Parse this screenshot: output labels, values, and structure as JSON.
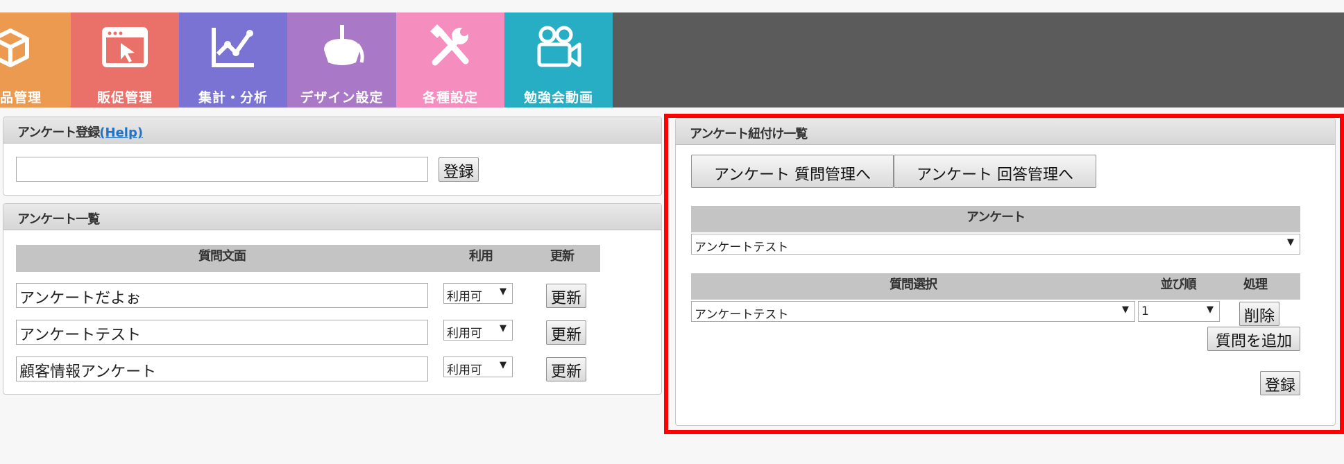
{
  "nav": [
    {
      "label": "品管理",
      "bg": "#ec9a4f",
      "icon": "box-icon"
    },
    {
      "label": "販促管理",
      "bg": "#e9716a",
      "icon": "browser-cursor-icon"
    },
    {
      "label": "集計・分析",
      "bg": "#7a73d4",
      "icon": "line-chart-icon"
    },
    {
      "label": "デザイン設定",
      "bg": "#a978c6",
      "icon": "paint-bucket-icon"
    },
    {
      "label": "各種設定",
      "bg": "#f58dbf",
      "icon": "tools-icon"
    },
    {
      "label": "勉強会動画",
      "bg": "#27aec4",
      "icon": "video-camera-icon"
    }
  ],
  "register_panel": {
    "title": "アンケート登録",
    "help_link": "(Help)",
    "input_value": "",
    "submit_label": "登録"
  },
  "list_panel": {
    "title": "アンケート一覧",
    "headers": {
      "question": "質問文面",
      "usage": "利用",
      "update": "更新"
    },
    "rows": [
      {
        "question": "アンケートだよぉ",
        "usage": "利用可",
        "update_label": "更新"
      },
      {
        "question": "アンケートテスト",
        "usage": "利用可",
        "update_label": "更新"
      },
      {
        "question": "顧客情報アンケート",
        "usage": "利用可",
        "update_label": "更新"
      }
    ]
  },
  "link_panel": {
    "title": "アンケート紐付け一覧",
    "btn_question_mgmt": "アンケート 質問管理へ",
    "btn_answer_mgmt": "アンケート 回答管理へ",
    "survey_header": "アンケート",
    "survey_selected": "アンケートテスト",
    "question_headers": {
      "select": "質問選択",
      "order": "並び順",
      "action": "処理"
    },
    "question_selected": "アンケートテスト",
    "order_selected": "1",
    "delete_label": "削除",
    "add_question_label": "質問を追加",
    "register_label": "登録"
  },
  "highlight_color": "#ff0000"
}
